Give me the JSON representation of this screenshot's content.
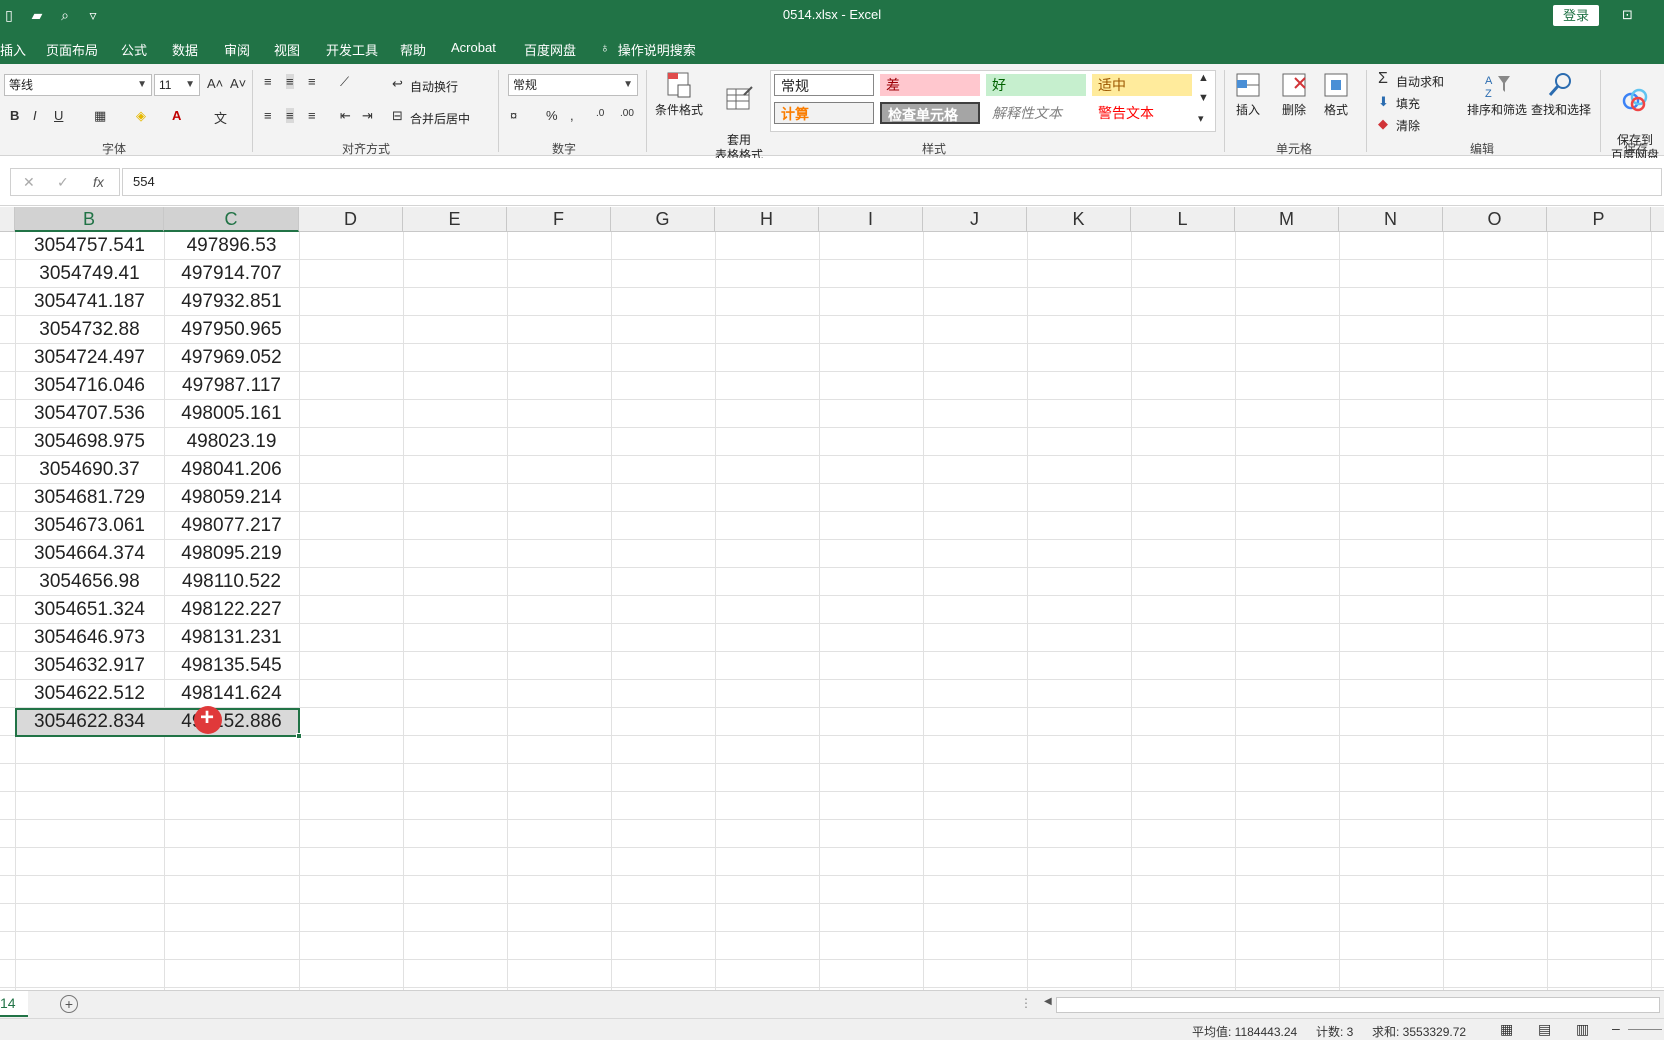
{
  "title_bar": {
    "file_title": "0514.xlsx  -  Excel",
    "login_label": "登录"
  },
  "menu_tabs": [
    "插入",
    "页面布局",
    "公式",
    "数据",
    "审阅",
    "视图",
    "开发工具",
    "帮助",
    "Acrobat",
    "百度网盘"
  ],
  "tell_me": "操作说明搜索",
  "ribbon": {
    "font_name": "等线",
    "font_size": "11",
    "wrap_text": "自动换行",
    "merge_center": "合并后居中",
    "number_format": "常规",
    "cond_format": "条件格式",
    "table_format": "套用\n表格格式",
    "styles": {
      "normal": "常规",
      "bad": "差",
      "good": "好",
      "neutral": "适中",
      "calc": "计算",
      "check": "检查单元格",
      "explain": "解释性文本",
      "warn": "警告文本"
    },
    "insert": "插入",
    "delete": "删除",
    "format": "格式",
    "autosum": "自动求和",
    "fill": "填充",
    "clear": "清除",
    "sort_filter": "排序和筛选",
    "find_select": "查找和选择",
    "save_baidu": "保存到\n百度网盘",
    "groups": {
      "font": "字体",
      "align": "对齐方式",
      "number": "数字",
      "styles": "样式",
      "cells": "单元格",
      "editing": "编辑",
      "save": "保存"
    }
  },
  "formula_bar": {
    "value": "554"
  },
  "columns": [
    "B",
    "C",
    "D",
    "E",
    "F",
    "G",
    "H",
    "I",
    "J",
    "K",
    "L",
    "M",
    "N",
    "O",
    "P"
  ],
  "rows": [
    [
      "3054757.541",
      "497896.53"
    ],
    [
      "3054749.41",
      "497914.707"
    ],
    [
      "3054741.187",
      "497932.851"
    ],
    [
      "3054732.88",
      "497950.965"
    ],
    [
      "3054724.497",
      "497969.052"
    ],
    [
      "3054716.046",
      "497987.117"
    ],
    [
      "3054707.536",
      "498005.161"
    ],
    [
      "3054698.975",
      "498023.19"
    ],
    [
      "3054690.37",
      "498041.206"
    ],
    [
      "3054681.729",
      "498059.214"
    ],
    [
      "3054673.061",
      "498077.217"
    ],
    [
      "3054664.374",
      "498095.219"
    ],
    [
      "3054656.98",
      "498110.522"
    ],
    [
      "3054651.324",
      "498122.227"
    ],
    [
      "3054646.973",
      "498131.231"
    ],
    [
      "3054632.917",
      "498135.545"
    ],
    [
      "3054622.512",
      "498141.624"
    ],
    [
      "3054622.834",
      "498152.886"
    ]
  ],
  "sheet_tab": "14",
  "status": {
    "average": "平均值: 1184443.24",
    "count": "计数: 3",
    "sum": "求和: 3553329.72"
  },
  "colors": {
    "excel_green": "#217346",
    "bad_bg": "#ffc7ce",
    "good_bg": "#c6efce",
    "neutral_bg": "#ffeb9c"
  }
}
